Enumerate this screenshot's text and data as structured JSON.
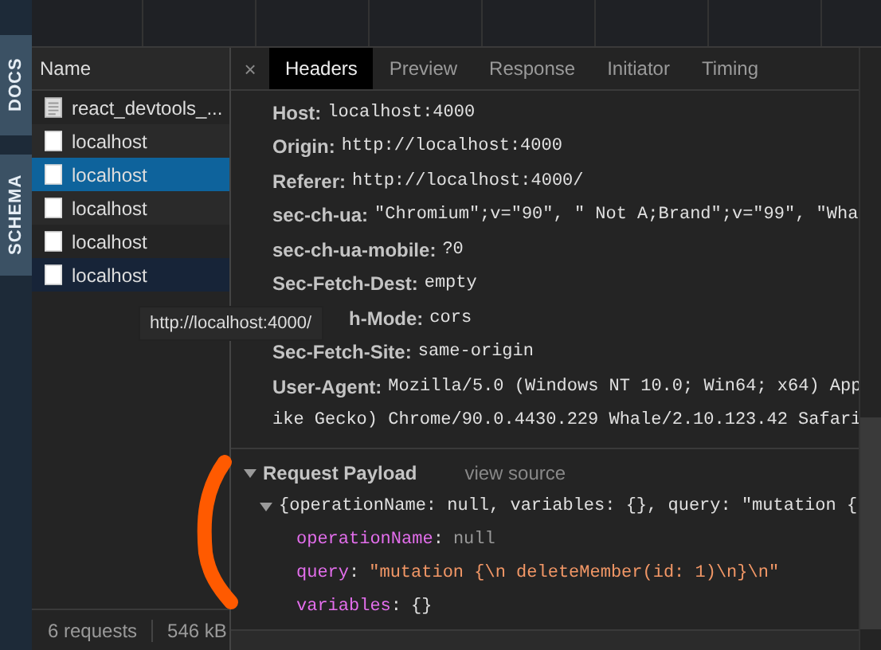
{
  "side_tabs": [
    {
      "label": "DOCS",
      "selected": false
    },
    {
      "label": "SCHEMA",
      "selected": false
    }
  ],
  "network": {
    "column": "Name",
    "rows": [
      {
        "name": "react_devtools_...",
        "kind": "document",
        "selected": false
      },
      {
        "name": "localhost",
        "kind": "blank",
        "selected": false
      },
      {
        "name": "localhost",
        "kind": "blank",
        "selected": true
      },
      {
        "name": "localhost",
        "kind": "blank",
        "selected": false
      },
      {
        "name": "localhost",
        "kind": "blank",
        "selected": false
      },
      {
        "name": "localhost",
        "kind": "blank",
        "selected": false,
        "hovered": true
      }
    ],
    "status": {
      "requests": "6 requests",
      "size": "546 kB"
    }
  },
  "details": {
    "close": "×",
    "tabs": [
      {
        "label": "Headers",
        "selected": true
      },
      {
        "label": "Preview",
        "selected": false
      },
      {
        "label": "Response",
        "selected": false
      },
      {
        "label": "Initiator",
        "selected": false
      },
      {
        "label": "Timing",
        "selected": false
      }
    ],
    "headers": [
      {
        "kind": "header",
        "name": "Host:",
        "value": "localhost:4000"
      },
      {
        "kind": "header",
        "name": "Origin:",
        "value": "http://localhost:4000"
      },
      {
        "kind": "header",
        "name": "Referer:",
        "value": "http://localhost:4000/"
      },
      {
        "kind": "header",
        "name": "sec-ch-ua:",
        "value": "\"Chromium\";v=\"90\", \" Not A;Brand\";v=\"99\", \"Wha"
      },
      {
        "kind": "header",
        "name": "sec-ch-ua-mobile:",
        "value": "?0"
      },
      {
        "kind": "header",
        "name": "Sec-Fetch-Dest:",
        "value": "empty"
      },
      {
        "kind": "covered",
        "name": "h-Mode:",
        "value": "cors"
      },
      {
        "kind": "header",
        "name": "Sec-Fetch-Site:",
        "value": "same-origin"
      },
      {
        "kind": "header",
        "name": "User-Agent:",
        "value": "Mozilla/5.0 (Windows NT 10.0; Win64; x64) App"
      },
      {
        "kind": "continuation",
        "value": "ike Gecko) Chrome/90.0.4430.229 Whale/2.10.123.42 Safari"
      }
    ],
    "payload": {
      "title": "Request Payload",
      "expanded": true,
      "view_source": "view source",
      "summary": "{operationName: null, variables: {}, query: \"mutation {",
      "summary_expanded": true,
      "fields": [
        {
          "key": "operationName",
          "colon": ":",
          "value": "null",
          "kind": "null"
        },
        {
          "key": "query",
          "colon": ":",
          "value": "\"mutation {\\n  deleteMember(id: 1)\\n}\\n\"",
          "kind": "string"
        },
        {
          "key": "variables",
          "colon": ":",
          "value": "{}",
          "kind": "object"
        }
      ]
    }
  },
  "tooltip": "http://localhost:4000/"
}
